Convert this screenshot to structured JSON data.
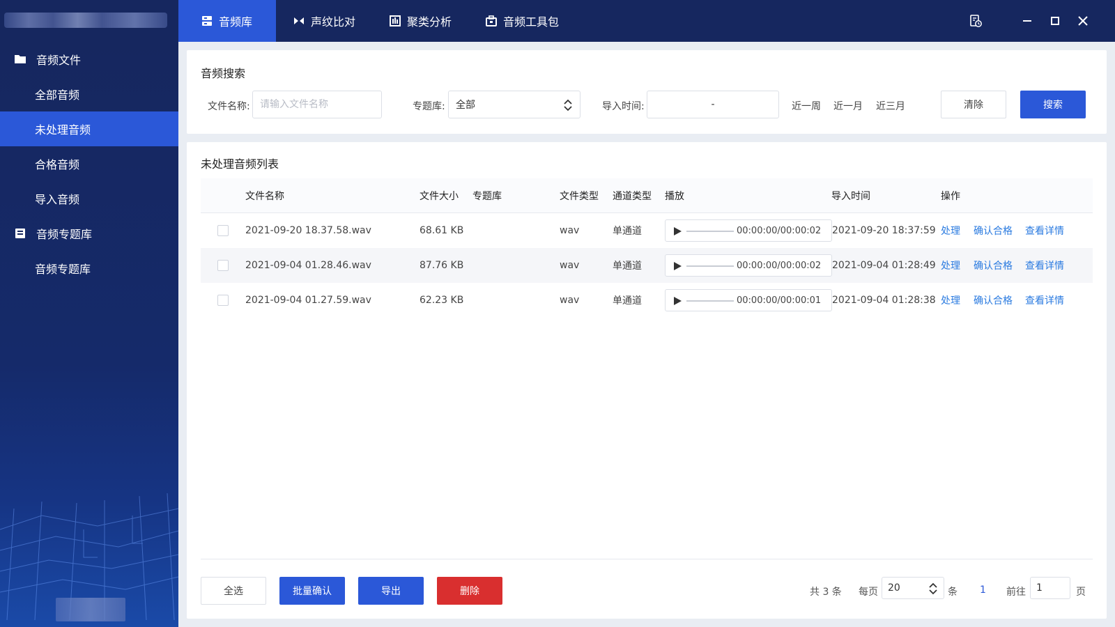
{
  "window": {
    "nav": [
      {
        "label": "音频库",
        "icon": "database-icon",
        "active": true
      },
      {
        "label": "声纹比对",
        "icon": "compare-icon",
        "active": false
      },
      {
        "label": "聚类分析",
        "icon": "bar-chart-icon",
        "active": false
      },
      {
        "label": "音频工具包",
        "icon": "toolbox-icon",
        "active": false
      }
    ]
  },
  "sidebar": {
    "groups": [
      {
        "label": "音频文件",
        "icon": "folder-icon",
        "items": [
          {
            "label": "全部音频",
            "active": false
          },
          {
            "label": "未处理音频",
            "active": true
          },
          {
            "label": "合格音频",
            "active": false
          },
          {
            "label": "导入音频",
            "active": false
          }
        ]
      },
      {
        "label": "音频专题库",
        "icon": "library-icon",
        "items": [
          {
            "label": "音频专题库",
            "active": false
          }
        ]
      }
    ]
  },
  "search": {
    "title": "音频搜索",
    "filename_label": "文件名称:",
    "filename_placeholder": "请输入文件名称",
    "filename_value": "",
    "topic_label": "专题库:",
    "topic_value": "全部",
    "import_time_label": "导入时间:",
    "date_separator": "-",
    "quick": [
      "近一周",
      "近一月",
      "近三月"
    ],
    "clear_label": "清除",
    "search_label": "搜索"
  },
  "list": {
    "title": "未处理音频列表",
    "columns": {
      "name": "文件名称",
      "size": "文件大小",
      "topic": "专题库",
      "type": "文件类型",
      "channel": "通道类型",
      "play": "播放",
      "import_time": "导入时间",
      "ops": "操作"
    },
    "rows": [
      {
        "name": "2021-09-20 18.37.58.wav",
        "size": "68.61 KB",
        "topic": "",
        "type": "wav",
        "channel": "单通道",
        "time_display": "00:00:00/00:00:02",
        "import_time": "2021-09-20 18:37:59"
      },
      {
        "name": "2021-09-04 01.28.46.wav",
        "size": "87.76 KB",
        "topic": "",
        "type": "wav",
        "channel": "单通道",
        "time_display": "00:00:00/00:00:02",
        "import_time": "2021-09-04 01:28:49"
      },
      {
        "name": "2021-09-04 01.27.59.wav",
        "size": "62.23 KB",
        "topic": "",
        "type": "wav",
        "channel": "单通道",
        "time_display": "00:00:00/00:00:01",
        "import_time": "2021-09-04 01:28:38"
      }
    ],
    "row_ops": {
      "process": "处理",
      "confirm": "确认合格",
      "detail": "查看详情"
    }
  },
  "footer": {
    "select_all": "全选",
    "batch_confirm": "批量确认",
    "export": "导出",
    "delete": "删除"
  },
  "pager": {
    "total": "共 3 条",
    "per_page_label": "每页",
    "per_page_value": "20",
    "per_page_unit": "条",
    "current_page": "1",
    "goto_label": "前往",
    "goto_value": "1",
    "goto_unit": "页"
  },
  "colors": {
    "header_bg": "#16275f",
    "accent": "#2b58d8",
    "danger": "#d92f2f",
    "link": "#2b7be0"
  }
}
